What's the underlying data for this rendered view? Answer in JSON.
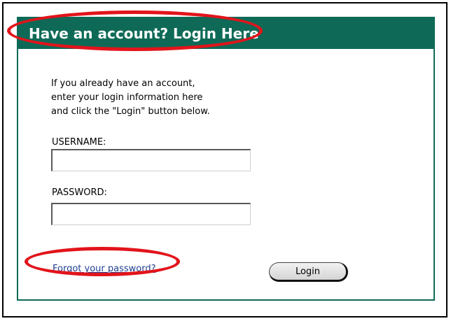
{
  "header": {
    "title": "Have an account? Login Here"
  },
  "intro": {
    "lines": [
      "If you already have an account,",
      "enter your login information here",
      "and click the \"Login\" button below."
    ]
  },
  "form": {
    "username_label": "USERNAME:",
    "username_value": "",
    "password_label": "PASSWORD:",
    "password_value": ""
  },
  "links": {
    "forgot_password": "Forgot your password?"
  },
  "buttons": {
    "login": "Login"
  },
  "colors": {
    "header_bg": "#0e6a57",
    "annotation": "#e2141b",
    "link": "#1f3f8f"
  }
}
